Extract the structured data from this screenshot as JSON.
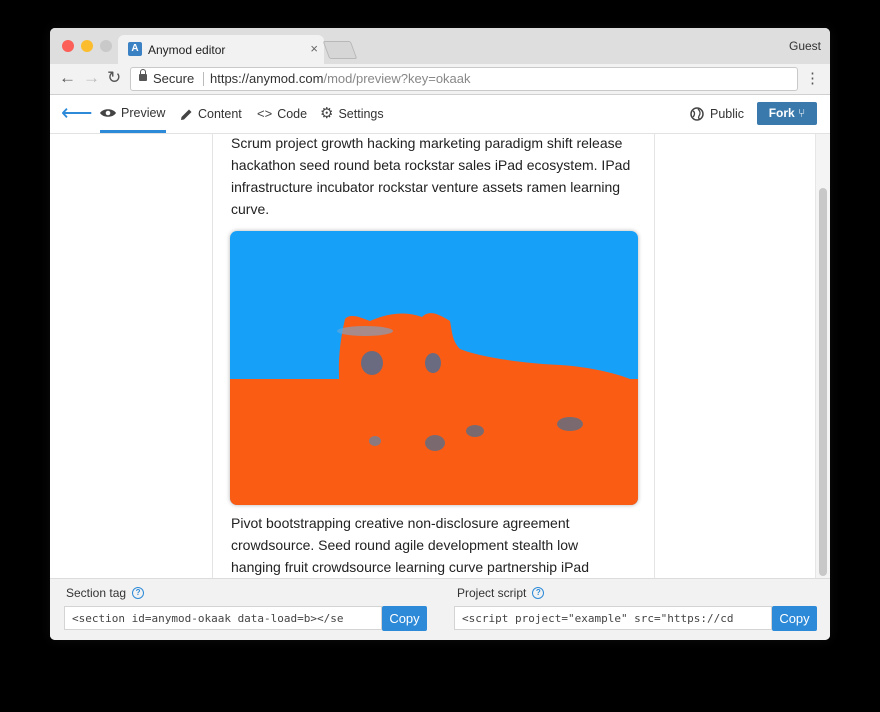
{
  "browser": {
    "tab_title": "Anymod editor",
    "tab_favicon": "A",
    "tab_close": "×",
    "profile": "Guest",
    "secure_label": "Secure",
    "url_host": "https://anymod.com",
    "url_path": "/mod/preview?key=okaak"
  },
  "appbar": {
    "tabs": [
      {
        "label": "Preview",
        "icon": "eye-icon"
      },
      {
        "label": "Content",
        "icon": "pencil-icon"
      },
      {
        "label": "Code",
        "icon": "code-icon"
      },
      {
        "label": "Settings",
        "icon": "gear-icon"
      }
    ],
    "active_tab": "Preview",
    "public_label": "Public",
    "fork_label": "Fork"
  },
  "content": {
    "paragraph_1": "Scrum project growth hacking marketing paradigm shift release hackathon seed round beta rockstar sales iPad ecosystem. IPad infrastructure incubator rockstar venture assets ramen learning curve.",
    "paragraph_2": "Pivot bootstrapping creative non-disclosure agreement crowdsource. Seed round agile development stealth low hanging fruit crowdsource learning curve partnership iPad"
  },
  "footer": {
    "section_tag_label": "Section tag",
    "section_tag_value": "<section id=anymod-okaak data-load=b></se",
    "project_script_label": "Project script",
    "project_script_value": "<script project=\"example\" src=\"https://cd",
    "copy_label": "Copy",
    "help_glyph": "?"
  },
  "colors": {
    "accent": "#2d8ad8",
    "fork_button": "#3a79ab",
    "photo_sky": "#16a0f8",
    "photo_subject": "#fb5c14"
  }
}
